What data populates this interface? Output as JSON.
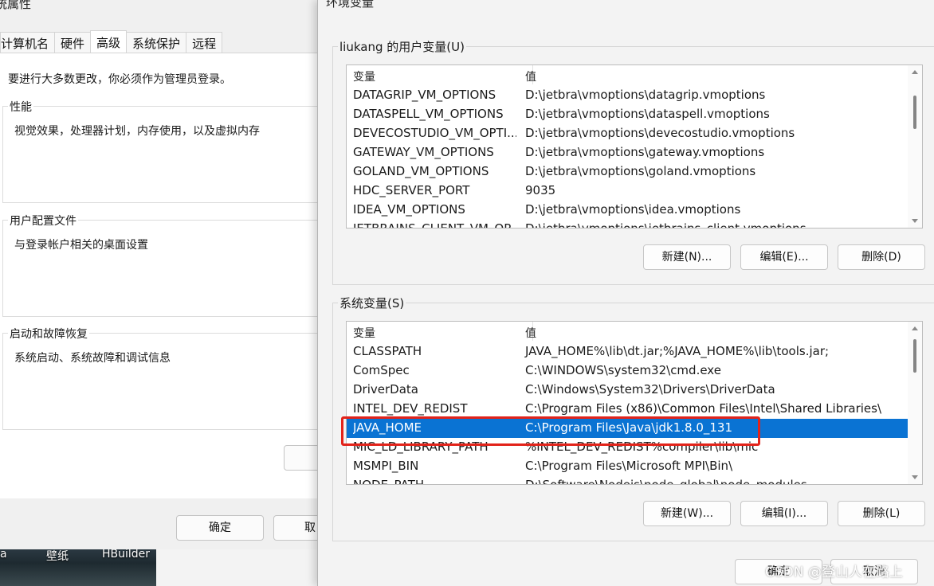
{
  "system_properties": {
    "title": "统属性",
    "tabs": [
      "计算机名",
      "硬件",
      "高级",
      "系统保护",
      "远程"
    ],
    "active_tab": "高级",
    "admin_note": "要进行大多数更改，你必须作为管理员登录。",
    "groups": [
      {
        "legend": "性能",
        "desc": "视觉效果，处理器计划，内存使用，以及虚拟内存"
      },
      {
        "legend": "用户配置文件",
        "desc": "与登录帐户相关的桌面设置"
      },
      {
        "legend": "启动和故障恢复",
        "desc": "系统启动、系统故障和调试信息"
      }
    ],
    "ok_label": "确定",
    "cancel_label": "取"
  },
  "desktop": {
    "labels": [
      "a",
      "壁纸",
      "HBuilder"
    ]
  },
  "env_vars": {
    "title": "环境变量",
    "user_section": {
      "legend": "liukang 的用户变量(U)",
      "col_name": "变量",
      "col_value": "值",
      "rows": [
        {
          "name": "DATAGRIP_VM_OPTIONS",
          "value": "D:\\jetbra\\vmoptions\\datagrip.vmoptions"
        },
        {
          "name": "DATASPELL_VM_OPTIONS",
          "value": "D:\\jetbra\\vmoptions\\dataspell.vmoptions"
        },
        {
          "name": "DEVECOSTUDIO_VM_OPTI...",
          "value": "D:\\jetbra\\vmoptions\\devecostudio.vmoptions"
        },
        {
          "name": "GATEWAY_VM_OPTIONS",
          "value": "D:\\jetbra\\vmoptions\\gateway.vmoptions"
        },
        {
          "name": "GOLAND_VM_OPTIONS",
          "value": "D:\\jetbra\\vmoptions\\goland.vmoptions"
        },
        {
          "name": "HDC_SERVER_PORT",
          "value": "9035"
        },
        {
          "name": "IDEA_VM_OPTIONS",
          "value": "D:\\jetbra\\vmoptions\\idea.vmoptions"
        },
        {
          "name": "JETBRAINS_CLIENT_VM_OP...",
          "value": "D:\\jetbra\\vmoptions\\jetbrains_client.vmoptions"
        }
      ],
      "buttons": {
        "new": "新建(N)...",
        "edit": "编辑(E)...",
        "delete": "删除(D)"
      }
    },
    "system_section": {
      "legend": "系统变量(S)",
      "col_name": "变量",
      "col_value": "值",
      "rows": [
        {
          "name": "CLASSPATH",
          "value": "JAVA_HOME%\\lib\\dt.jar;%JAVA_HOME%\\lib\\tools.jar;"
        },
        {
          "name": "ComSpec",
          "value": "C:\\WINDOWS\\system32\\cmd.exe"
        },
        {
          "name": "DriverData",
          "value": "C:\\Windows\\System32\\Drivers\\DriverData"
        },
        {
          "name": "INTEL_DEV_REDIST",
          "value": "C:\\Program Files (x86)\\Common Files\\Intel\\Shared Libraries\\"
        },
        {
          "name": "JAVA_HOME",
          "value": "C:\\Program Files\\Java\\jdk1.8.0_131",
          "selected": true
        },
        {
          "name": "MIC_LD_LIBRARY_PATH",
          "value": "%INTEL_DEV_REDIST%compiler\\lib\\mic"
        },
        {
          "name": "MSMPI_BIN",
          "value": "C:\\Program Files\\Microsoft MPI\\Bin\\"
        },
        {
          "name": "NODE_PATH",
          "value": "D:\\Software\\Nodejs\\node_global\\node_modules"
        }
      ],
      "buttons": {
        "new": "新建(W)...",
        "edit": "编辑(I)...",
        "delete": "删除(L)"
      }
    },
    "ok_label": "确定",
    "cancel_label": "取消"
  },
  "watermark": "CSDN @登山人在路上",
  "colors": {
    "selection": "#0a73d3",
    "highlight_box": "#e2231a"
  }
}
